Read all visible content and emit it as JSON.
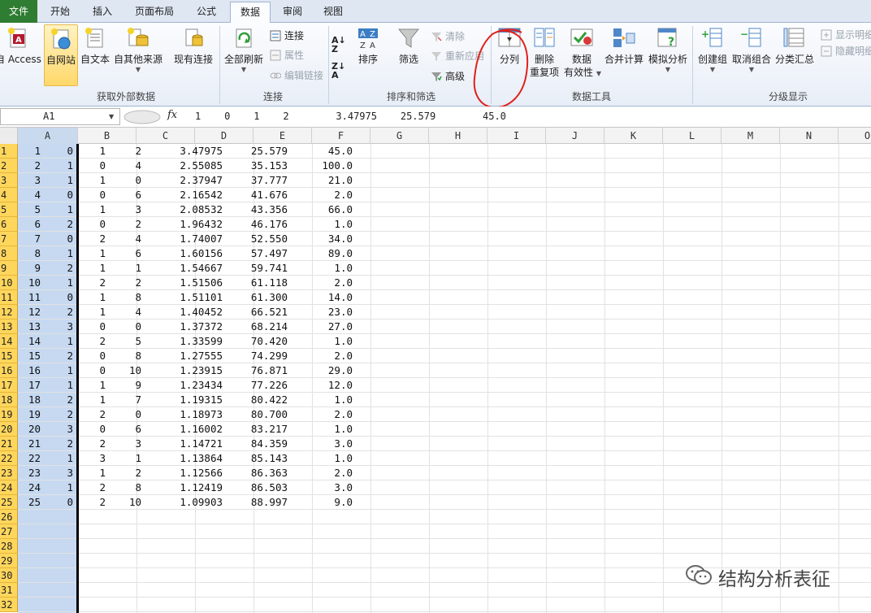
{
  "tabs": [
    {
      "label": "文件"
    },
    {
      "label": "开始"
    },
    {
      "label": "插入"
    },
    {
      "label": "页面布局"
    },
    {
      "label": "公式"
    },
    {
      "label": "数据"
    },
    {
      "label": "审阅"
    },
    {
      "label": "视图"
    }
  ],
  "ribbon": {
    "get_external": {
      "group_label": "获取外部数据",
      "from_access": "自 Access",
      "from_web": "自网站",
      "from_text": "自文本",
      "from_other": "自其他来源",
      "existing": "现有连接"
    },
    "connections": {
      "group_label": "连接",
      "refresh_all": "全部刷新",
      "connections": "连接",
      "properties": "属性",
      "edit_links": "编辑链接"
    },
    "sort_filter": {
      "group_label": "排序和筛选",
      "sort": "排序",
      "filter": "筛选",
      "clear": "清除",
      "reapply": "重新应用",
      "advanced": "高级"
    },
    "data_tools": {
      "group_label": "数据工具",
      "text_to_columns": "分列",
      "remove_dup_1": "删除",
      "remove_dup_2": "重复项",
      "validation_1": "数据",
      "validation_2": "有效性",
      "consolidate": "合并计算",
      "whatif": "模拟分析"
    },
    "outline": {
      "group_label": "分级显示",
      "group": "创建组",
      "ungroup": "取消组合",
      "subtotal": "分类汇总",
      "show_detail": "显示明细",
      "hide_detail": "隐藏明细"
    }
  },
  "formula_bar": {
    "name_box": "A1",
    "fx": "fx",
    "content": "1    0    1    2        3.47975    25.579        45.0"
  },
  "columns": [
    "A",
    "B",
    "C",
    "D",
    "E",
    "F",
    "G",
    "H",
    "I",
    "J",
    "K",
    "L",
    "M",
    "N",
    "O"
  ],
  "row_numbers": [
    "1",
    "2",
    "3",
    "4",
    "5",
    "6",
    "7",
    "8",
    "9",
    "10",
    "11",
    "12",
    "13",
    "14",
    "15",
    "16",
    "17",
    "18",
    "19",
    "20",
    "21",
    "22",
    "23",
    "24",
    "25",
    "26",
    "27",
    "28",
    "29",
    "30",
    "31",
    "32"
  ],
  "rows": [
    [
      "1",
      "0",
      "1",
      "2",
      "3.47975",
      "25.579",
      "45.0"
    ],
    [
      "2",
      "1",
      "0",
      "4",
      "2.55085",
      "35.153",
      "100.0"
    ],
    [
      "3",
      "1",
      "1",
      "0",
      "2.37947",
      "37.777",
      "21.0"
    ],
    [
      "4",
      "0",
      "0",
      "6",
      "2.16542",
      "41.676",
      "2.0"
    ],
    [
      "5",
      "1",
      "1",
      "3",
      "2.08532",
      "43.356",
      "66.0"
    ],
    [
      "6",
      "2",
      "0",
      "2",
      "1.96432",
      "46.176",
      "1.0"
    ],
    [
      "7",
      "0",
      "2",
      "4",
      "1.74007",
      "52.550",
      "34.0"
    ],
    [
      "8",
      "1",
      "1",
      "6",
      "1.60156",
      "57.497",
      "89.0"
    ],
    [
      "9",
      "2",
      "1",
      "1",
      "1.54667",
      "59.741",
      "1.0"
    ],
    [
      "10",
      "1",
      "2",
      "2",
      "1.51506",
      "61.118",
      "2.0"
    ],
    [
      "11",
      "0",
      "1",
      "8",
      "1.51101",
      "61.300",
      "14.0"
    ],
    [
      "12",
      "2",
      "1",
      "4",
      "1.40452",
      "66.521",
      "23.0"
    ],
    [
      "13",
      "3",
      "0",
      "0",
      "1.37372",
      "68.214",
      "27.0"
    ],
    [
      "14",
      "1",
      "2",
      "5",
      "1.33599",
      "70.420",
      "1.0"
    ],
    [
      "15",
      "2",
      "0",
      "8",
      "1.27555",
      "74.299",
      "2.0"
    ],
    [
      "16",
      "1",
      "0",
      "10",
      "1.23915",
      "76.871",
      "29.0"
    ],
    [
      "17",
      "1",
      "1",
      "9",
      "1.23434",
      "77.226",
      "12.0"
    ],
    [
      "18",
      "2",
      "1",
      "7",
      "1.19315",
      "80.422",
      "1.0"
    ],
    [
      "19",
      "2",
      "2",
      "0",
      "1.18973",
      "80.700",
      "2.0"
    ],
    [
      "20",
      "3",
      "0",
      "6",
      "1.16002",
      "83.217",
      "1.0"
    ],
    [
      "21",
      "2",
      "2",
      "3",
      "1.14721",
      "84.359",
      "3.0"
    ],
    [
      "22",
      "1",
      "3",
      "1",
      "1.13864",
      "85.143",
      "1.0"
    ],
    [
      "23",
      "3",
      "1",
      "2",
      "1.12566",
      "86.363",
      "2.0"
    ],
    [
      "24",
      "1",
      "2",
      "8",
      "1.12419",
      "86.503",
      "3.0"
    ],
    [
      "25",
      "0",
      "2",
      "10",
      "1.09903",
      "88.997",
      "9.0"
    ]
  ],
  "watermark": {
    "text": "结构分析表征"
  },
  "colors": {
    "file_tab": "#2e7d32",
    "selection": "#c6d9f1",
    "row_header_selected": "#ffd65c",
    "annotation": "#e0201b"
  }
}
